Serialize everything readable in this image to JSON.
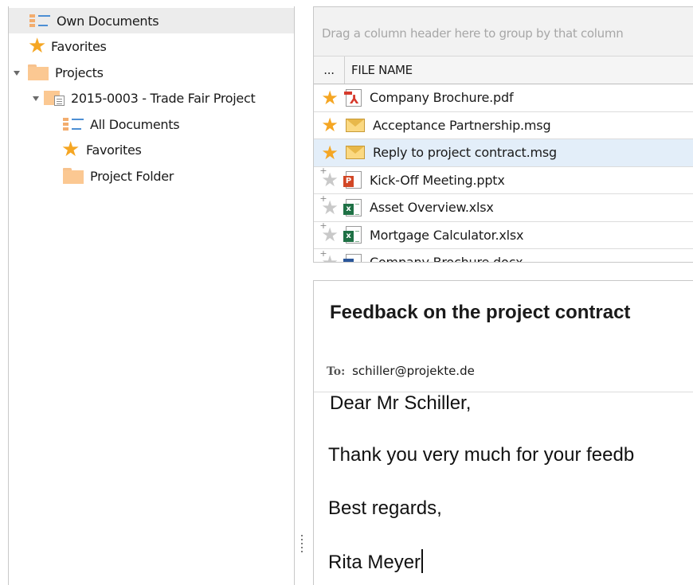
{
  "nav": {
    "items": [
      {
        "label": "Own Documents",
        "icon": "own-documents-icon",
        "selected": true
      },
      {
        "label": "Favorites",
        "icon": "star-icon"
      },
      {
        "label": "Projects",
        "icon": "folder-icon",
        "expanded": true
      },
      {
        "label": "2015-0003 - Trade Fair Project",
        "icon": "project-folder-icon",
        "expanded": true
      },
      {
        "label": "All Documents",
        "icon": "all-documents-icon"
      },
      {
        "label": "Favorites",
        "icon": "star-icon"
      },
      {
        "label": "Project Folder",
        "icon": "folder-icon"
      }
    ]
  },
  "grid": {
    "group_hint": "Drag a column header here to group by that column",
    "columns": {
      "more": "...",
      "file_name": "FILE NAME"
    },
    "rows": [
      {
        "name": "Company Brochure.pdf",
        "type": "pdf-icon",
        "favorite": true
      },
      {
        "name": "Acceptance Partnership.msg",
        "type": "mail-icon",
        "favorite": true
      },
      {
        "name": "Reply to project contract.msg",
        "type": "mail-icon",
        "favorite": true,
        "selected": true
      },
      {
        "name": "Kick-Off Meeting.pptx",
        "type": "powerpoint-icon",
        "favorite": false
      },
      {
        "name": "Asset Overview.xlsx",
        "type": "excel-icon",
        "favorite": false
      },
      {
        "name": "Mortgage Calculator.xlsx",
        "type": "excel-icon",
        "favorite": false
      },
      {
        "name": "Company Brochure.docx",
        "type": "word-icon",
        "favorite": false
      }
    ]
  },
  "preview": {
    "subject": "Feedback on the project contract",
    "to_label": "To:",
    "to": "schiller@projekte.de",
    "body": {
      "greeting": "Dear Mr Schiller,",
      "line1": "Thank you very much for your feedb",
      "closing": "Best regards,",
      "signature": "Rita Meyer"
    }
  },
  "colors": {
    "accent_star": "#f5a623",
    "selected_row": "#e3eef9",
    "tree_selected": "#ececec"
  }
}
